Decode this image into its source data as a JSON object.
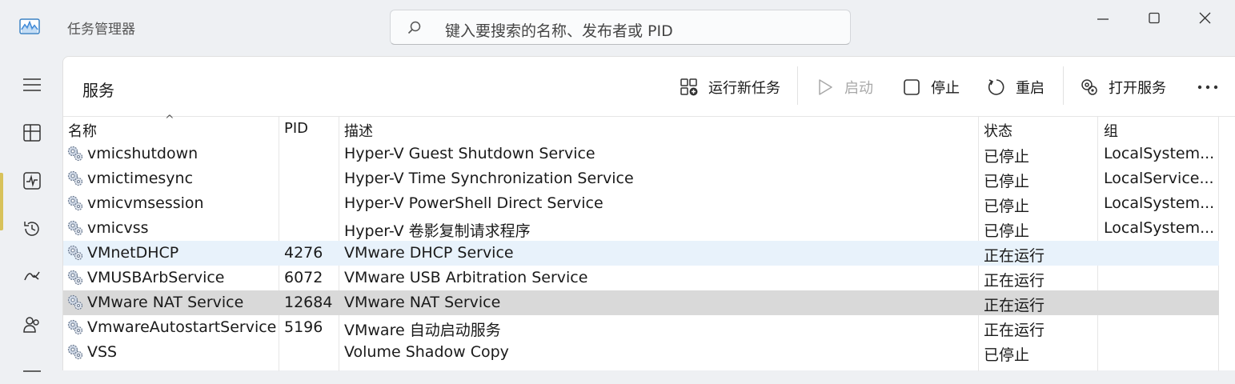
{
  "app": {
    "title": "任务管理器"
  },
  "search": {
    "placeholder": "键入要搜索的名称、发布者或 PID"
  },
  "page": {
    "title": "服务"
  },
  "toolbar": {
    "run_new_task": "运行新任务",
    "start": "启动",
    "stop": "停止",
    "restart": "重启",
    "open_services": "打开服务",
    "more": "更多"
  },
  "table": {
    "columns": {
      "name": "名称",
      "pid": "PID",
      "desc": "描述",
      "status": "状态",
      "group": "组"
    },
    "rows": [
      {
        "name": "vmicshutdown",
        "pid": "",
        "desc": "Hyper-V Guest Shutdown Service",
        "status": "已停止",
        "group": "LocalSystem..."
      },
      {
        "name": "vmictimesync",
        "pid": "",
        "desc": "Hyper-V Time Synchronization Service",
        "status": "已停止",
        "group": "LocalService..."
      },
      {
        "name": "vmicvmsession",
        "pid": "",
        "desc": "Hyper-V PowerShell Direct Service",
        "status": "已停止",
        "group": "LocalSystem..."
      },
      {
        "name": "vmicvss",
        "pid": "",
        "desc": "Hyper-V 卷影复制请求程序",
        "status": "已停止",
        "group": "LocalSystem..."
      },
      {
        "name": "VMnetDHCP",
        "pid": "4276",
        "desc": "VMware DHCP Service",
        "status": "正在运行",
        "group": ""
      },
      {
        "name": "VMUSBArbService",
        "pid": "6072",
        "desc": "VMware USB Arbitration Service",
        "status": "正在运行",
        "group": ""
      },
      {
        "name": "VMware NAT Service",
        "pid": "12684",
        "desc": "VMware NAT Service",
        "status": "正在运行",
        "group": ""
      },
      {
        "name": "VmwareAutostartService",
        "pid": "5196",
        "desc": "VMware 自动启动服务",
        "status": "正在运行",
        "group": ""
      },
      {
        "name": "VSS",
        "pid": "",
        "desc": "Volume Shadow Copy",
        "status": "已停止",
        "group": ""
      }
    ]
  }
}
